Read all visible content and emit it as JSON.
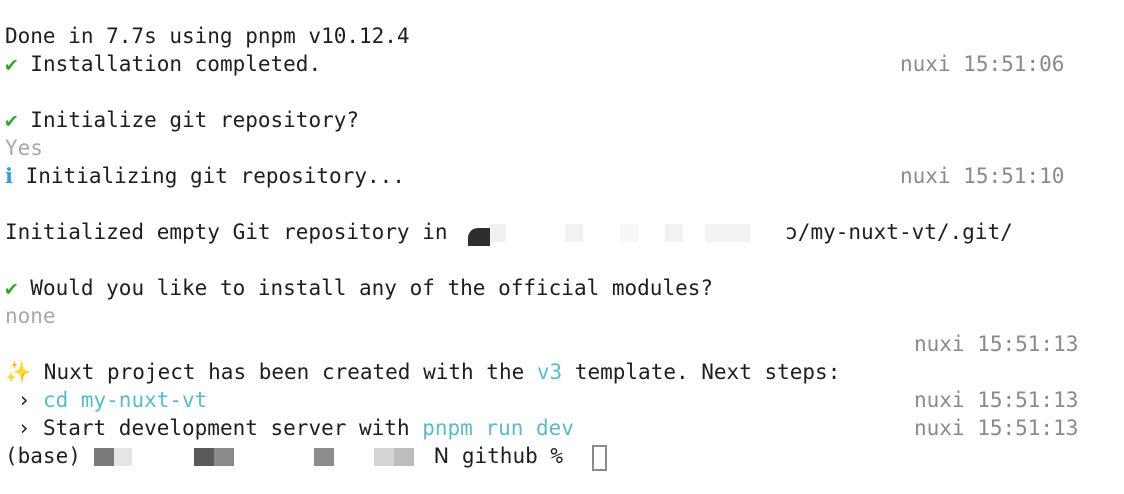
{
  "lines": {
    "done": "Done in 7.7s using pnpm v10.12.4",
    "install_check": "✔",
    "install_text": " Installation completed.",
    "install_ts": "nuxi 15:51:06",
    "git_q_check": "✔",
    "git_q_text": " Initialize git repository?",
    "git_answer": "Yes",
    "init_info": "ℹ",
    "init_text": " Initializing git repository...",
    "init_ts": "nuxi 15:51:10",
    "empty_repo_prefix": "Initialized empty Git repository in ",
    "empty_repo_suffix": "ɔ/my-nuxt-vt/.git/",
    "modules_check": "✔",
    "modules_text": " Would you like to install any of the official modules?",
    "modules_answer": "none",
    "created_ts": "nuxi 15:51:13",
    "sparkle": "✨",
    "created_prefix": " Nuxt project has been created with the ",
    "created_template": "v3",
    "created_suffix": " template. Next steps:",
    "step1_arrow": " › ",
    "step1_cmd": "cd my-nuxt-vt",
    "step1_ts": "nuxi 15:51:13",
    "step2_arrow": " › ",
    "step2_text": "Start development server with ",
    "step2_cmd": "pnpm run dev",
    "step2_ts": "nuxi 15:51:13",
    "prompt_env": "(base) ",
    "prompt_partial": "ꓠ",
    "prompt_dir": " github % "
  },
  "colors": {
    "background": "#ffffff",
    "text": "#1e1e1e",
    "check": "#3aa53a",
    "info": "#3a9bd9",
    "muted": "#a8a8a8",
    "cyan": "#5bbcc7",
    "timestamp": "#8a8a8a"
  }
}
